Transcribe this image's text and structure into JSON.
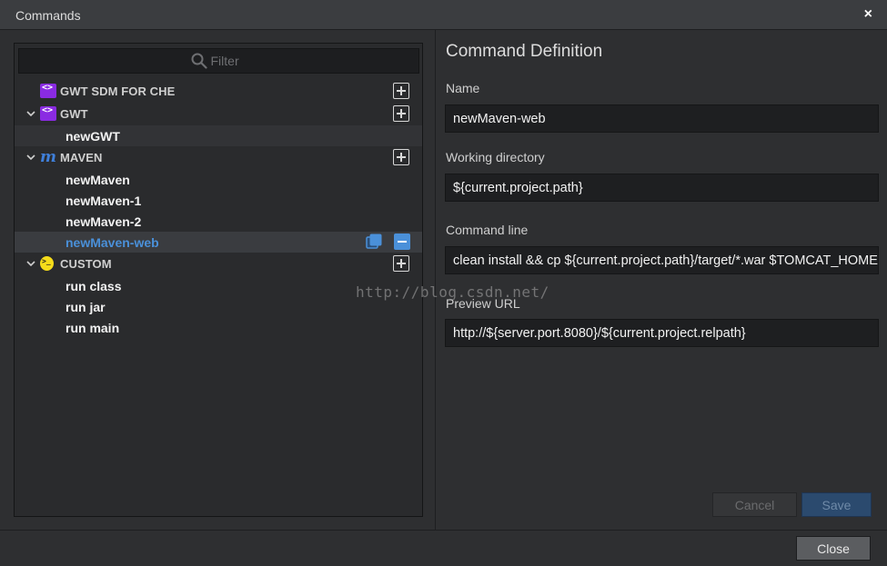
{
  "window": {
    "title": "Commands",
    "close_glyph": "×"
  },
  "filter": {
    "placeholder": "Filter",
    "icon": "search-icon"
  },
  "tree": {
    "groups": [
      {
        "label": "GWT SDM FOR CHE",
        "icon": "gwt-icon",
        "expanded": false,
        "items": []
      },
      {
        "label": "GWT",
        "icon": "gwt-icon",
        "expanded": true,
        "items": [
          "newGWT"
        ]
      },
      {
        "label": "MAVEN",
        "icon": "maven-icon",
        "expanded": true,
        "items": [
          "newMaven",
          "newMaven-1",
          "newMaven-2",
          "newMaven-web"
        ]
      },
      {
        "label": "CUSTOM",
        "icon": "terminal-icon",
        "expanded": true,
        "items": [
          "run class",
          "run jar",
          "run main"
        ]
      }
    ],
    "selected_item": "newMaven-web"
  },
  "definition": {
    "title": "Command Definition",
    "name_label": "Name",
    "name_value": "newMaven-web",
    "workdir_label": "Working directory",
    "workdir_value": "${current.project.path}",
    "cmdline_label": "Command line",
    "cmdline_value": "clean install && cp ${current.project.path}/target/*.war $TOMCAT_HOME/webapps/ROOT.war",
    "preview_label": "Preview URL",
    "preview_value": "http://${server.port.8080}/${current.project.relpath}",
    "cancel_label": "Cancel",
    "save_label": "Save"
  },
  "footer": {
    "close_label": "Close"
  },
  "watermark": "http://blog.csdn.net/",
  "colors": {
    "accent": "#4a90d9",
    "gwt": "#8a2be2",
    "maven": "#3f7fd9",
    "custom": "#f5dc1a"
  }
}
